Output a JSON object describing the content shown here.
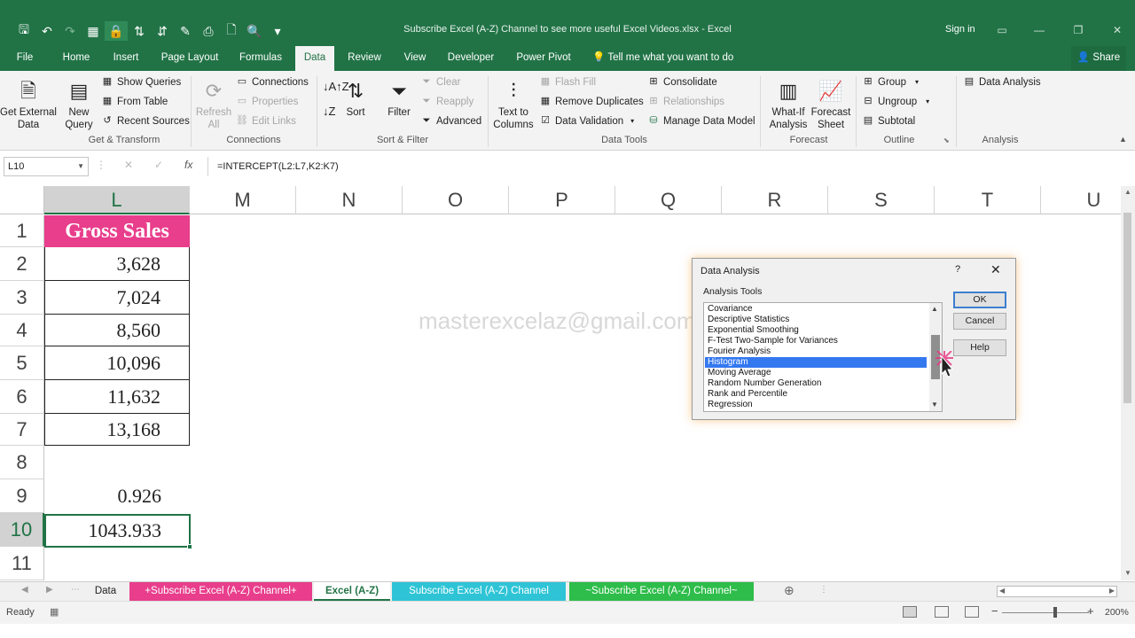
{
  "title_bar": {
    "document_title": "Subscribe Excel (A-Z) Channel to see more useful Excel Videos.xlsx - Excel",
    "sign_in": "Sign in",
    "colors": {
      "title_bar": "#217346",
      "tab_active_text": "#217346"
    }
  },
  "quick_access": [
    {
      "name": "save-icon",
      "glyph": "🖫"
    },
    {
      "name": "undo-icon",
      "glyph": "↶"
    },
    {
      "name": "redo-icon",
      "glyph": "↷"
    },
    {
      "name": "table-icon",
      "glyph": "▦"
    },
    {
      "name": "lock-icon",
      "glyph": "🔒"
    },
    {
      "name": "sort-asc-icon",
      "glyph": "⇅"
    },
    {
      "name": "sort-desc-icon",
      "glyph": "⇵"
    },
    {
      "name": "format-painter-icon",
      "glyph": "✎"
    },
    {
      "name": "print-icon",
      "glyph": "⎙"
    },
    {
      "name": "new-file-icon",
      "glyph": "🗋"
    },
    {
      "name": "print-preview-icon",
      "glyph": "🔍"
    },
    {
      "name": "customize-icon",
      "glyph": "▾"
    }
  ],
  "tabs": {
    "file": "File",
    "home": "Home",
    "insert": "Insert",
    "page_layout": "Page Layout",
    "formulas": "Formulas",
    "data": "Data",
    "review": "Review",
    "view": "View",
    "developer": "Developer",
    "power_pivot": "Power Pivot",
    "tell_me": "Tell me what you want to do",
    "share": "Share"
  },
  "ribbon": {
    "get_transform": {
      "get_external_data": "Get External\nData",
      "new_query": "New\nQuery",
      "show_queries": "Show Queries",
      "from_table": "From Table",
      "recent_sources": "Recent Sources",
      "label": "Get & Transform"
    },
    "connections": {
      "refresh_all": "Refresh\nAll",
      "connections": "Connections",
      "properties": "Properties",
      "edit_links": "Edit Links",
      "label": "Connections"
    },
    "sort_filter": {
      "sort": "Sort",
      "filter": "Filter",
      "clear": "Clear",
      "reapply": "Reapply",
      "advanced": "Advanced",
      "label": "Sort & Filter"
    },
    "data_tools": {
      "text_to_columns": "Text to\nColumns",
      "flash_fill": "Flash Fill",
      "remove_duplicates": "Remove Duplicates",
      "data_validation": "Data Validation",
      "consolidate": "Consolidate",
      "relationships": "Relationships",
      "manage_data_model": "Manage Data Model",
      "label": "Data Tools"
    },
    "forecast": {
      "what_if": "What-If\nAnalysis",
      "forecast_sheet": "Forecast\nSheet",
      "label": "Forecast"
    },
    "outline": {
      "group": "Group",
      "ungroup": "Ungroup",
      "subtotal": "Subtotal",
      "label": "Outline"
    },
    "analysis": {
      "data_analysis": "Data Analysis",
      "label": "Analysis"
    }
  },
  "formula_bar": {
    "name_box": "L10",
    "formula": "=INTERCEPT(L2:L7,K2:K7)"
  },
  "grid": {
    "columns": [
      "L",
      "M",
      "N",
      "O",
      "P",
      "Q",
      "R",
      "S",
      "T",
      "U"
    ],
    "rows": [
      "1",
      "2",
      "3",
      "4",
      "5",
      "6",
      "7",
      "8",
      "9",
      "10",
      "11"
    ],
    "header_cell": "Gross Sales",
    "header_color": "#e83e8c",
    "values": [
      "3,628",
      "7,024",
      "8,560",
      "10,096",
      "11,632",
      "13,168"
    ],
    "row9_value": "0.926",
    "row10_value": "1043.933",
    "watermark": "masterexcelaz@gmail.com"
  },
  "dialog": {
    "title": "Data Analysis",
    "help_glyph": "?",
    "close_glyph": "✕",
    "list_label": "Analysis Tools",
    "items": [
      "Covariance",
      "Descriptive Statistics",
      "Exponential Smoothing",
      "F-Test Two-Sample for Variances",
      "Fourier Analysis",
      "Histogram",
      "Moving Average",
      "Random Number Generation",
      "Rank and Percentile",
      "Regression"
    ],
    "selected": "Histogram",
    "ok": "OK",
    "cancel": "Cancel",
    "help": "Help"
  },
  "sheet_tabs": [
    {
      "label": "Data",
      "bg": "#f0f0f0",
      "fg": "#333"
    },
    {
      "label": "+Subscribe Excel (A-Z) Channel+",
      "bg": "#e83e8c",
      "fg": "#ffffff"
    },
    {
      "label": "Excel (A-Z)",
      "bg": "#ffffff",
      "fg": "#217346"
    },
    {
      "label": "Subscribe Excel (A-Z) Channel",
      "bg": "#2ec4d6",
      "fg": "#ffffff"
    },
    {
      "label": "~Subscribe Excel (A-Z) Channel~",
      "bg": "#2ebd4a",
      "fg": "#ffffff"
    }
  ],
  "status_bar": {
    "ready": "Ready",
    "zoom": "200%"
  }
}
